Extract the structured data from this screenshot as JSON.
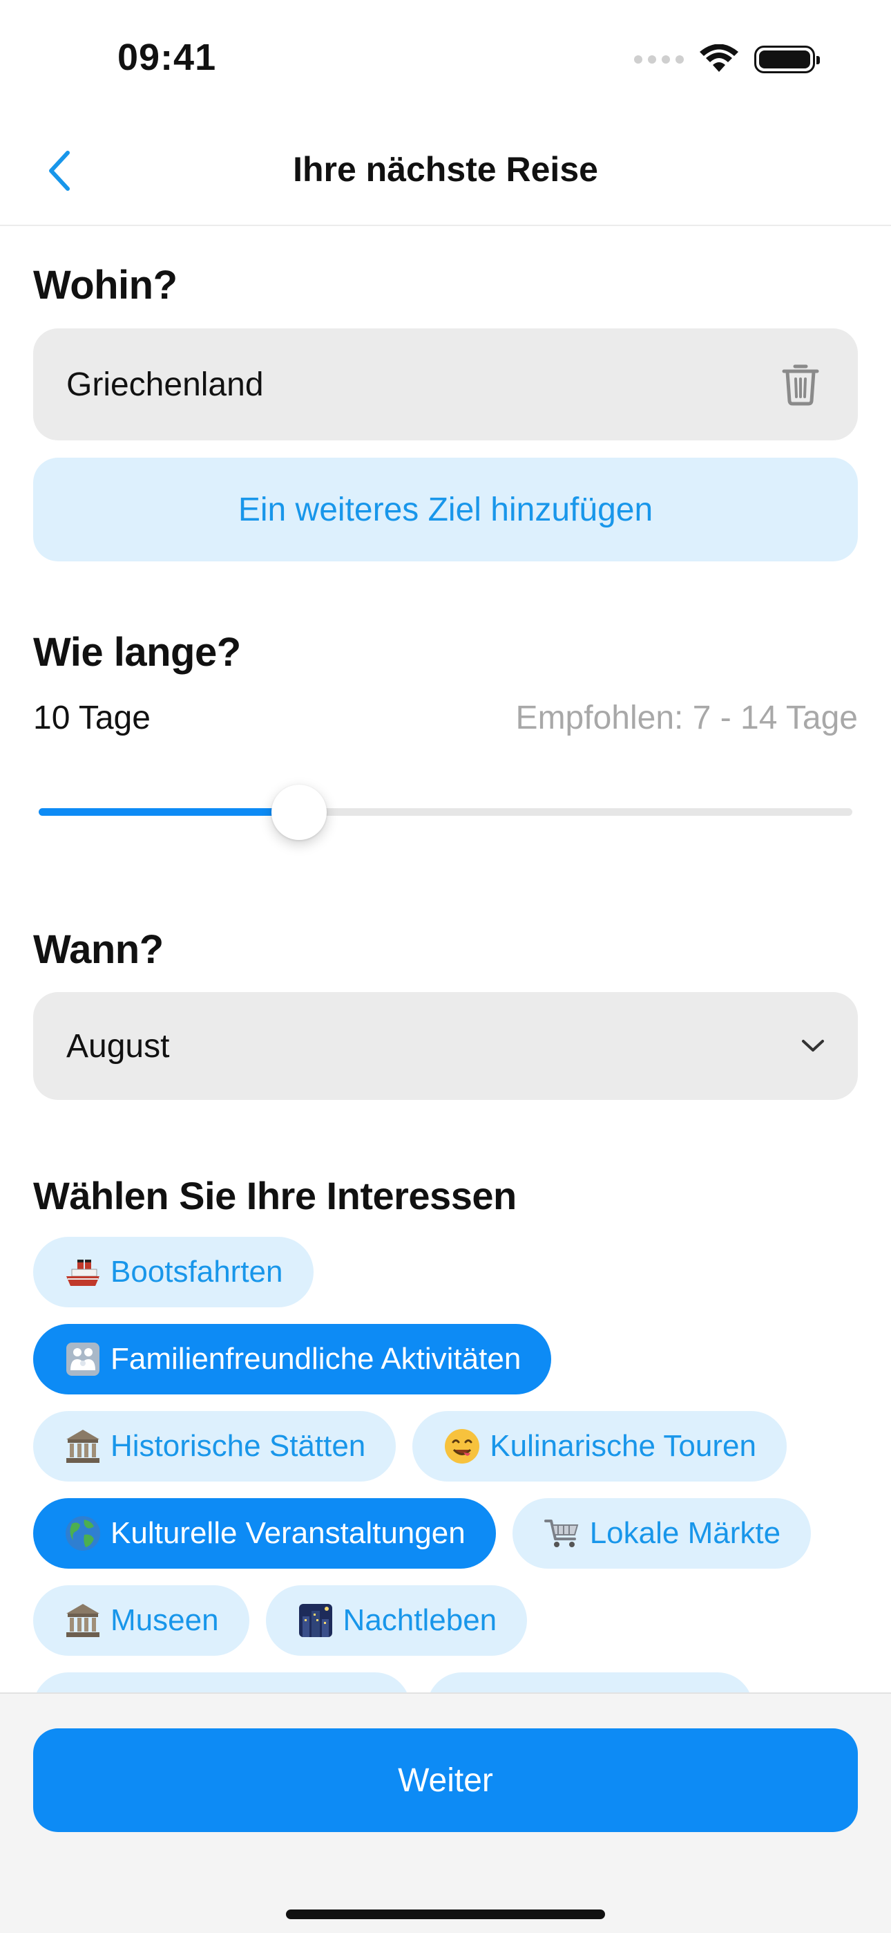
{
  "status_bar": {
    "time": "09:41"
  },
  "nav": {
    "title": "Ihre nächste Reise"
  },
  "destination": {
    "title": "Wohin?",
    "value": "Griechenland",
    "add_label": "Ein weiteres Ziel hinzufügen"
  },
  "duration": {
    "title": "Wie lange?",
    "value_label": "10 Tage",
    "hint": "Empfohlen: 7 - 14 Tage",
    "slider_fraction": 0.32
  },
  "month": {
    "title": "Wann?",
    "value": "August"
  },
  "interests": {
    "title": "Wählen Sie Ihre Interessen",
    "chips": [
      {
        "label": "Bootsfahrten",
        "icon": "ship-icon",
        "selected": false
      },
      {
        "label": "Familienfreundliche Aktivitäten",
        "icon": "family-icon",
        "selected": true
      },
      {
        "label": "Historische Stätten",
        "icon": "classical-building-icon",
        "selected": false
      },
      {
        "label": "Kulinarische Touren",
        "icon": "yummy-face-icon",
        "selected": false
      },
      {
        "label": "Kulturelle Veranstaltungen",
        "icon": "globe-icon",
        "selected": true
      },
      {
        "label": "Lokale Märkte",
        "icon": "shopping-cart-icon",
        "selected": false
      },
      {
        "label": "Museen",
        "icon": "classical-building-icon",
        "selected": false
      },
      {
        "label": "Nachtleben",
        "icon": "night-city-icon",
        "selected": false
      }
    ]
  },
  "footer": {
    "next_label": "Weiter"
  },
  "colors": {
    "accent": "#0d8bf5",
    "accent_light": "#ddf0fd",
    "accent_text": "#1896ea",
    "field_bg": "#ebebeb"
  }
}
